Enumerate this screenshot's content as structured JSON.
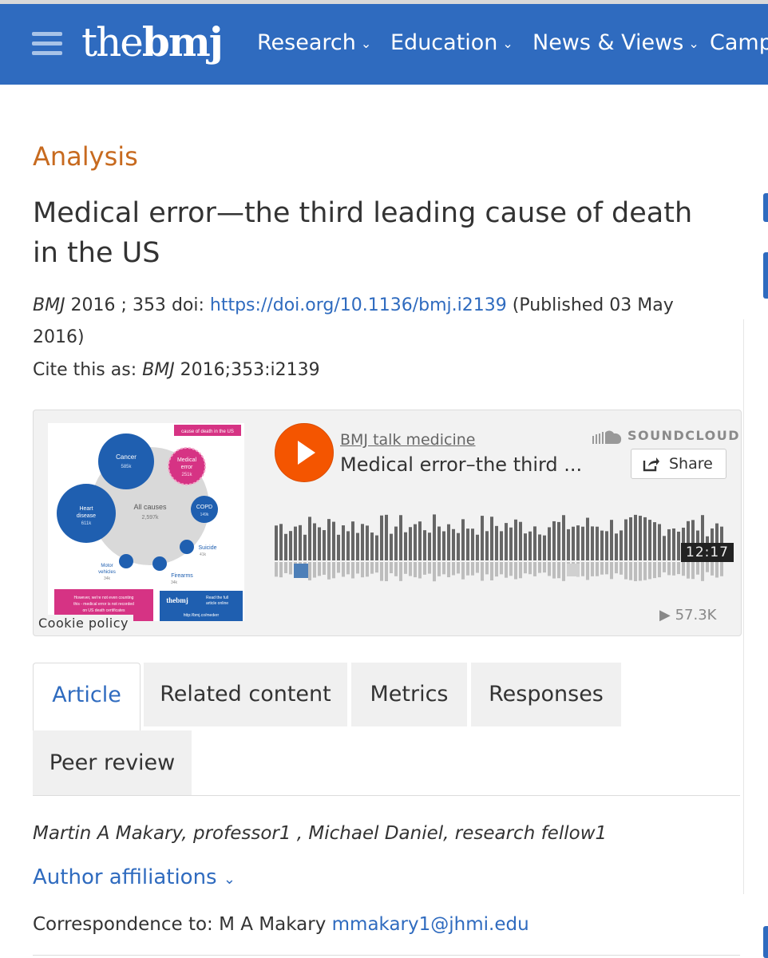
{
  "nav": {
    "logo_the": "the",
    "logo_bmj": "bmj",
    "items": [
      {
        "label": "Research"
      },
      {
        "label": "Education"
      },
      {
        "label": "News & Views"
      },
      {
        "label": "Camp"
      }
    ]
  },
  "article": {
    "kicker": "Analysis",
    "title": "Medical error—the third leading cause of death in the US",
    "journal": "BMJ",
    "year_vol": " 2016 ; 353 ",
    "doi_label": " doi: ",
    "doi_link": "https://doi.org/10.1136/bmj.i2139",
    "published": " (Published 03 May 2016)",
    "cite_prefix": "Cite this as: ",
    "cite_journal": "BMJ",
    "cite_ref": " 2016;353:i2139"
  },
  "player": {
    "uploader": "BMJ talk medicine",
    "track": "Medical error–the third ...",
    "brand": "SOUNDCLOUD",
    "share_label": "Share",
    "duration": "12:17",
    "plays": "57.3K",
    "cookie_label": "Cookie policy",
    "artwork": {
      "header_tag": "cause of death in the US",
      "center_label": "All causes",
      "center_value": "2,597k",
      "bubbles": [
        {
          "label": "Cancer",
          "value": "585k"
        },
        {
          "label": "Medical error",
          "value": "251k"
        },
        {
          "label": "Heart disease",
          "value": "611k"
        },
        {
          "label": "COPD",
          "value": "149k"
        },
        {
          "label": "Suicide",
          "value": "41k"
        },
        {
          "label": "Motor vehicles",
          "value": "34k"
        },
        {
          "label": "Firearms",
          "value": "34k"
        }
      ],
      "note": "However, we're not even counting this - medical error is not recorded on US death certificates",
      "promo_brand": "thebmj",
      "promo_text": "Read the full article online",
      "promo_url": "http://bmj.co/mederr"
    }
  },
  "tabs": [
    {
      "label": "Article",
      "active": true
    },
    {
      "label": "Related content",
      "active": false
    },
    {
      "label": "Metrics",
      "active": false
    },
    {
      "label": "Responses",
      "active": false
    },
    {
      "label": "Peer review",
      "active": false
    }
  ],
  "authors": "Martin A Makary, professor1 ,  Michael Daniel, research fellow1",
  "affiliations_label": "Author affiliations",
  "correspondence": {
    "prefix": "Correspondence to: M A Makary ",
    "email": "mmakary1@jhmi.edu"
  },
  "colors": {
    "nav_bg": "#2f6bbf",
    "kicker": "#c76a1f",
    "link": "#2f6bbf",
    "soundcloud_orange": "#f45500",
    "artwork_pink": "#d63384"
  }
}
